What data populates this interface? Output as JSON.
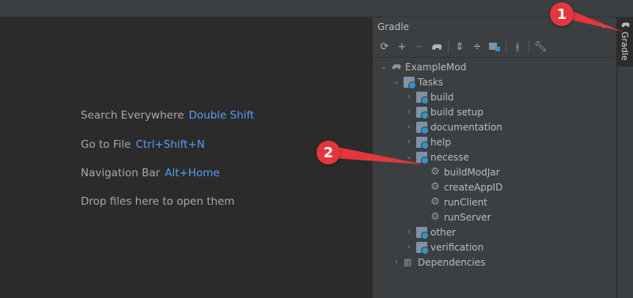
{
  "editor": {
    "hints": [
      {
        "text": "Search Everywhere",
        "key": "Double Shift"
      },
      {
        "text": "Go to File",
        "key": "Ctrl+Shift+N"
      },
      {
        "text": "Navigation Bar",
        "key": "Alt+Home"
      },
      {
        "text": "Drop files here to open them",
        "key": ""
      }
    ]
  },
  "gradle": {
    "title": "Gradle",
    "toolbar_icons": [
      "refresh-icon",
      "add-icon",
      "remove-icon",
      "elephant-icon",
      "expand-all-icon",
      "collapse-all-icon",
      "group-icon",
      "toggle-offline-icon",
      "wrench-icon"
    ],
    "tree": {
      "root": "ExampleMod",
      "tasks": "Tasks",
      "groups": [
        "build",
        "build setup",
        "documentation",
        "help",
        "necesse"
      ],
      "necesse_tasks": [
        "buildModJar",
        "createAppID",
        "runClient",
        "runServer"
      ],
      "more_groups": [
        "other",
        "verification"
      ],
      "dependencies": "Dependencies"
    }
  },
  "side_tab": {
    "label": "Gradle"
  },
  "annotations": {
    "marker1": "1",
    "marker2": "2",
    "color": "#e5373b"
  }
}
